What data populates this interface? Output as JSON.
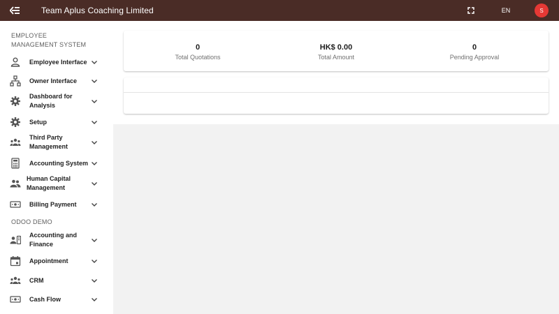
{
  "header": {
    "title": "Team Aplus Coaching Limited",
    "language": "EN",
    "avatar_initial": "S"
  },
  "sidebar": {
    "section1_title": "EMPLOYEE MANAGEMENT SYSTEM",
    "section2_title": "ODOO DEMO",
    "items": [
      {
        "label": "Employee Interface",
        "icon": "person-icon"
      },
      {
        "label": "Owner Interface",
        "icon": "org-chart-icon"
      },
      {
        "label": "Dashboard for Analysis",
        "icon": "gear-icon"
      },
      {
        "label": "Setup",
        "icon": "gear-icon"
      },
      {
        "label": "Third Party Management",
        "icon": "group-icon"
      },
      {
        "label": "Accounting System",
        "icon": "calculator-icon"
      },
      {
        "label": "Human Capital Management",
        "icon": "people-icon"
      },
      {
        "label": "Billing Payment",
        "icon": "money-icon"
      },
      {
        "label": "Accounting and Finance",
        "icon": "contact-icon"
      },
      {
        "label": "Appointment",
        "icon": "calendar-icon"
      },
      {
        "label": "CRM",
        "icon": "group-icon"
      },
      {
        "label": "Cash Flow",
        "icon": "money-icon"
      }
    ]
  },
  "summary": {
    "total_quotations_value": "0",
    "total_quotations_label": "Total Quotations",
    "total_amount_value": "HK$ 0.00",
    "total_amount_label": "Total Amount",
    "pending_value": "0",
    "pending_label": "Pending Approval"
  },
  "colors": {
    "header_bg": "#4a2c26",
    "avatar_bg": "#e53935"
  }
}
